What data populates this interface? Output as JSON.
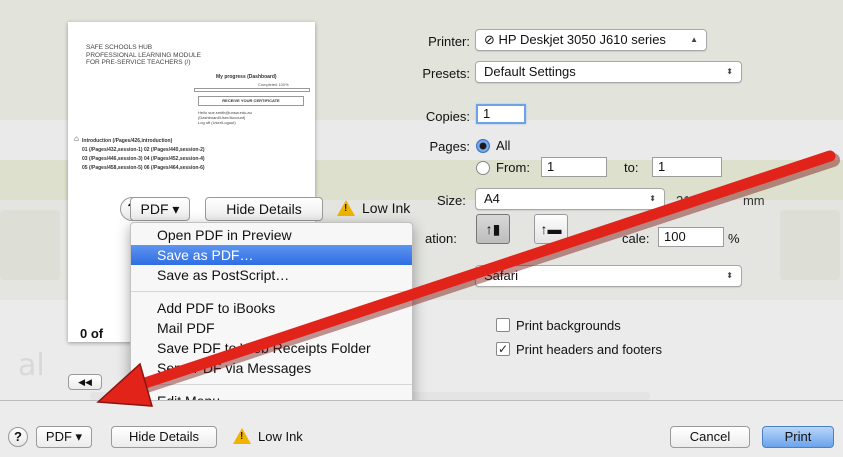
{
  "preview": {
    "title_lines": [
      "SAFE SCHOOLS HUB",
      "PROFESSIONAL LEARNING MODULE",
      "FOR PRE-SERVICE TEACHERS (/)"
    ],
    "progress_label": "My progress (Dashboard)",
    "completed": "Completed 100%",
    "certificate": "RECEIVE YOUR CERTIFICATE",
    "user_lines": [
      "Hello sue.smith@unsw.edu.au",
      "(Dashboard/User/Account)",
      "Log off (User/Logout)"
    ],
    "links": [
      "Introduction (/Pages/426,introduction)",
      "01 (/Pages/432,session-1)    02 (/Pages/440,session-2)",
      "03 (/Pages/446,session-3)    04 (/Pages/452,session-4)",
      "05 (/Pages/458,session-5)    06 (/Pages/464,session-6)"
    ],
    "pages_count": "0 of"
  },
  "printer": {
    "label": "Printer:",
    "value": "HP Deskjet 3050 J610 series"
  },
  "presets": {
    "label": "Presets:",
    "value": "Default Settings"
  },
  "copies": {
    "label": "Copies:",
    "value": "1"
  },
  "pages": {
    "label": "Pages:",
    "all_label": "All",
    "from_label": "From:",
    "from_value": "1",
    "to_label": "to:",
    "to_value": "1"
  },
  "paper_size": {
    "label": "Size:",
    "value": "A4",
    "dimensions_partial": "210",
    "unit_partial": "mm"
  },
  "orientation": {
    "label": "ation:"
  },
  "scale": {
    "label": "cale:",
    "value": "100",
    "unit": "%"
  },
  "app_popup": {
    "value": "Safari"
  },
  "options": {
    "print_backgrounds": "Print backgrounds",
    "print_headers_footers": "Print headers and footers"
  },
  "pdf_menu_bar": {
    "help": "?",
    "pdf": "PDF",
    "hide_details": "Hide Details",
    "low_ink": "Low Ink"
  },
  "pdf_menu": {
    "items": [
      "Open PDF in Preview",
      "Save as PDF…",
      "Save as PostScript…",
      "Add PDF to iBooks",
      "Mail PDF",
      "Save PDF to Web Receipts Folder",
      "Send PDF via Messages",
      "Edit Menu…"
    ]
  },
  "bottom": {
    "help": "?",
    "pdf": "PDF",
    "hide_details": "Hide Details",
    "low_ink": "Low Ink",
    "cancel": "Cancel",
    "print": "Print"
  },
  "background_text": {
    "al": "al"
  },
  "colors": {
    "arrow_red": "#e2231a",
    "highlight_blue": "#3a78e6",
    "primary_button": "#6aa3ec"
  }
}
